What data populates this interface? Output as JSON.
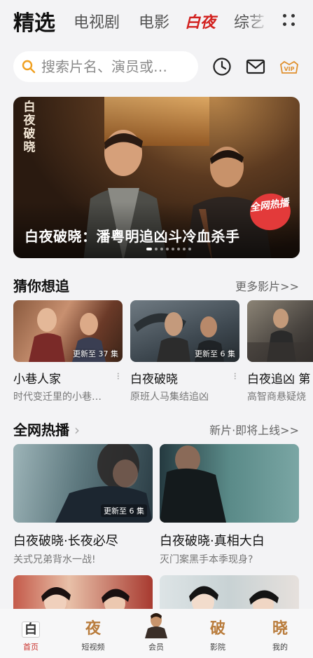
{
  "top_tabs": [
    {
      "label": "精选",
      "active": true
    },
    {
      "label": "电视剧"
    },
    {
      "label": "电影"
    },
    {
      "label": "白夜"
    },
    {
      "label": "综艺"
    }
  ],
  "search": {
    "placeholder": "搜索片名、演员或…"
  },
  "header_icons": [
    "history-icon",
    "mail-icon",
    "vip-icon"
  ],
  "vip_label": "VIP",
  "banner": {
    "logo": "白夜破晓",
    "title": "白夜破晓：潘粤明追凶斗冷血杀手",
    "badge": "全网热播",
    "dots": 8,
    "active_dot": 0
  },
  "guess": {
    "title": "猜你想追",
    "more": "更多影片>>",
    "items": [
      {
        "name": "小巷人家",
        "desc": "时代变迁里的小巷…",
        "ep": "更新至 37 集"
      },
      {
        "name": "白夜破晓",
        "desc": "原班人马集结追凶",
        "ep": "更新至 6 集"
      },
      {
        "name": "白夜追凶 第",
        "desc": "高智商悬疑烧",
        "ep": ""
      }
    ]
  },
  "hot": {
    "title": "全网热播",
    "more": "新片·即将上线>>",
    "items": [
      {
        "name": "白夜破晓·长夜必尽",
        "desc": "关式兄弟背水一战!",
        "ep": "更新至 6 集"
      },
      {
        "name": "白夜破晓·真相大白",
        "desc": "灭门案黑手本季现身?",
        "ep": ""
      }
    ]
  },
  "bottom_nav": [
    {
      "label": "首页",
      "glyph": "白",
      "active": true
    },
    {
      "label": "短视频",
      "glyph": "夜"
    },
    {
      "label": "会员",
      "glyph": ""
    },
    {
      "label": "影院",
      "glyph": "破"
    },
    {
      "label": "我的",
      "glyph": "晓"
    }
  ],
  "colors": {
    "accent": "#d2211f",
    "vip": "#e0912f",
    "search_icon": "#f0a020"
  }
}
